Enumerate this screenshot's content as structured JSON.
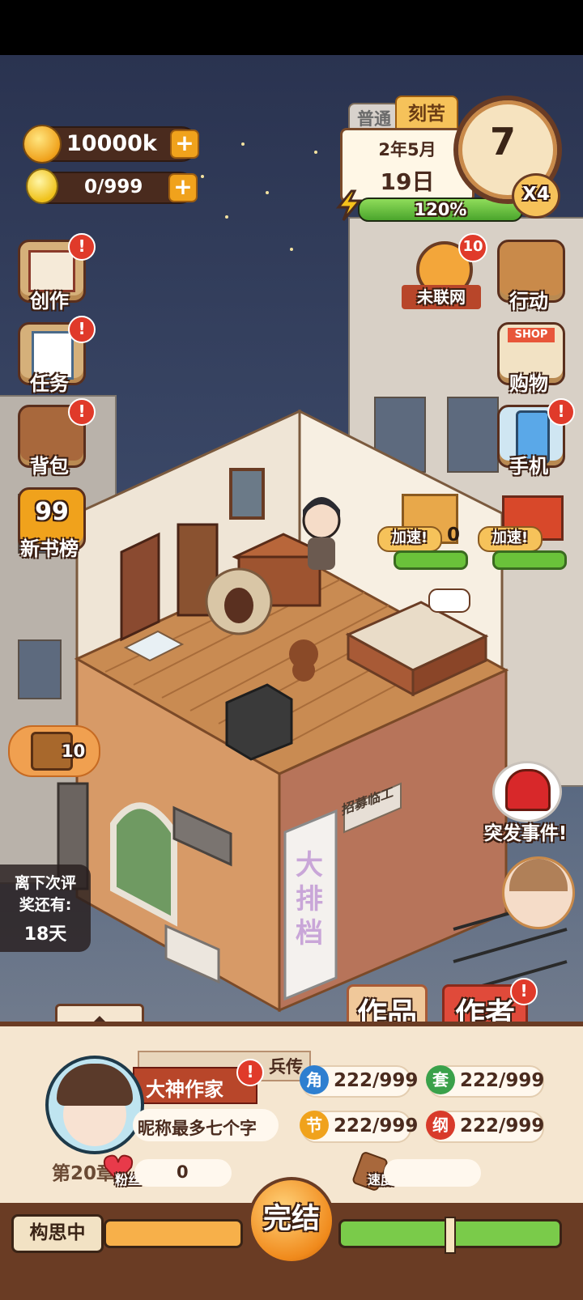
{
  "hud": {
    "coins": "10000k",
    "energy": "0/999",
    "difficulty_tabs": [
      "普通",
      "刻苦"
    ],
    "date_month": "2年5月",
    "date_day": "19日",
    "clock_value": "7",
    "speed": "X4",
    "progress": "120%",
    "progress_fraction": 1.0
  },
  "left_menu": [
    {
      "label": "创作",
      "icon": "book-icon",
      "alert": "!"
    },
    {
      "label": "任务",
      "icon": "checklist-icon",
      "alert": "!"
    },
    {
      "label": "背包",
      "icon": "bag-icon",
      "alert": "!"
    },
    {
      "label": "新书榜",
      "icon": "ranking-99-icon",
      "badge": "99"
    }
  ],
  "right_menu": [
    {
      "label": "未联网",
      "icon": "network-icon",
      "badge": "10"
    },
    {
      "label": "行动",
      "icon": "door-icon"
    },
    {
      "label": "购物",
      "icon": "shop-icon",
      "sign": "SHOP"
    },
    {
      "label": "手机",
      "icon": "phone-icon",
      "alert": "!"
    }
  ],
  "room": {
    "speedup_label": "加速!",
    "box_count": "0",
    "treasure_count": "10",
    "emergency_label": "突发事件!",
    "sign_recruit": "招募临工",
    "banner_text": "大排档"
  },
  "award_countdown": {
    "line1": "离下次评",
    "line2": "奖还有:",
    "days": "18天"
  },
  "tabs": {
    "works": "作品",
    "author": "作者",
    "author_alert": "!"
  },
  "profile": {
    "title": "大神作家",
    "title_alert": "!",
    "nickname": "昵称最多七个字",
    "chapter": "第20章",
    "fans_label": "粉丝",
    "fans_value": "0",
    "speed_label": "速度",
    "book_title_partial": "兵传"
  },
  "stats": [
    {
      "badge": "角",
      "value": "222/999",
      "color": "#2e7fd0"
    },
    {
      "badge": "套",
      "value": "222/999",
      "color": "#3aa14a"
    },
    {
      "badge": "节",
      "value": "222/999",
      "color": "#f0a21c"
    },
    {
      "badge": "纲",
      "value": "222/999",
      "color": "#d83a2a"
    }
  ],
  "bottom": {
    "status": "构思中",
    "finish_button": "完结"
  }
}
